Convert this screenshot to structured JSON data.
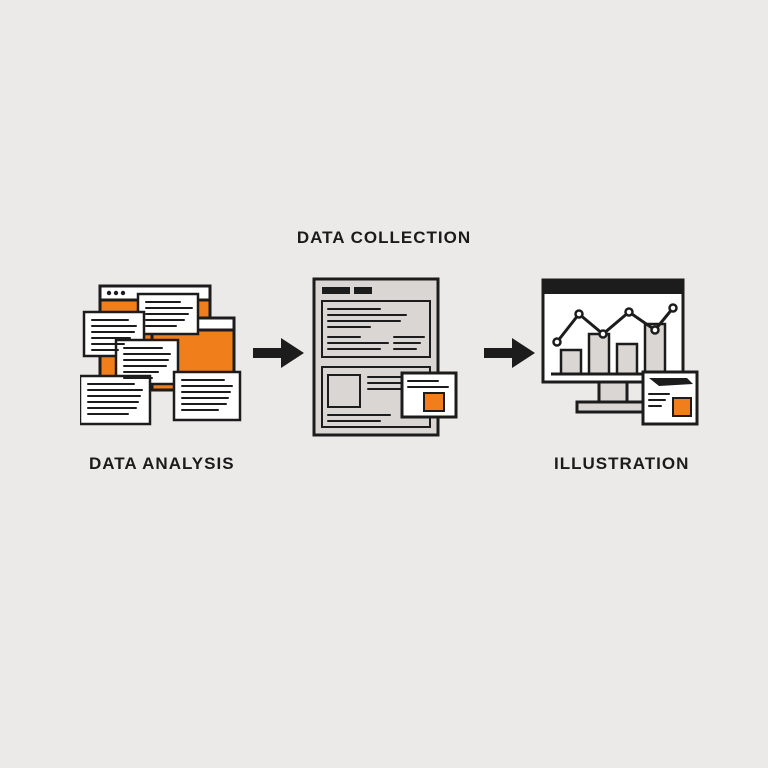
{
  "diagram": {
    "steps": [
      {
        "id": "data-analysis",
        "label": "DATA ANALYSIS",
        "label_pos": "bottom"
      },
      {
        "id": "data-collection",
        "label": "DATA COLLECTION",
        "label_pos": "top"
      },
      {
        "id": "illustration",
        "label": "ILLUSTRATION",
        "label_pos": "bottom"
      }
    ],
    "colors": {
      "accent": "#f07e1a",
      "ink": "#1c1c1c",
      "paper": "#ffffff",
      "panel": "#d9d6d4",
      "bg": "#ece9e9"
    }
  }
}
